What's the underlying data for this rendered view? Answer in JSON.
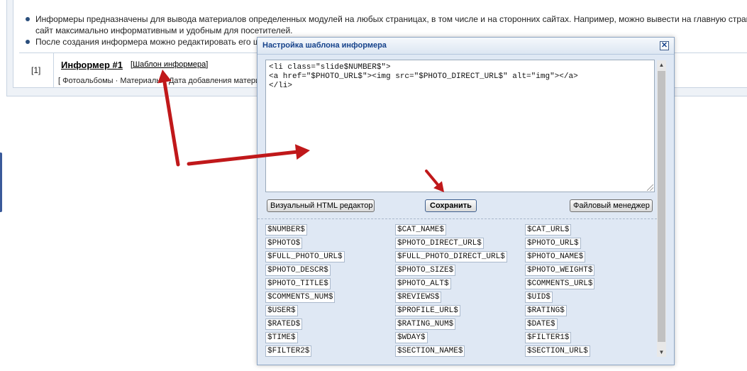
{
  "page": {
    "notes": [
      "Информеры предназначены для вывода материалов определенных модулей на любых страницах, в том числе и на сторонних сайтах. Например, можно вывести на главную страни",
      "После создания информера можно редактировать его ш"
    ],
    "note_continuation": "сайт максимально информативным и удобным для посетителей.",
    "informer": {
      "number": "[1]",
      "title": "Информер #1",
      "template_open": "[",
      "template_link": "Шаблон информера",
      "template_close": "]",
      "description": "[ Фотоальбомы · Материалы · Дата добавления материала"
    }
  },
  "dialog": {
    "title": "Настройка шаблона информера",
    "close_glyph": "✕",
    "template_code": "<li class=\"slide$NUMBER$\">\n<a href=\"$PHOTO_URL$\"><img src=\"$PHOTO_DIRECT_URL$\" alt=\"img\"></a>\n</li>",
    "buttons": {
      "visual_editor": "Визуальный HTML редактор",
      "save": "Сохранить",
      "file_manager": "Файловый менеджер"
    },
    "variables": [
      [
        "$NUMBER$",
        "$CAT_NAME$",
        "$CAT_URL$"
      ],
      [
        "$PHOTO$",
        "$PHOTO_DIRECT_URL$",
        "$PHOTO_URL$"
      ],
      [
        "$FULL_PHOTO_URL$",
        "$FULL_PHOTO_DIRECT_URL$",
        "$PHOTO_NAME$"
      ],
      [
        "$PHOTO_DESCR$",
        "$PHOTO_SIZE$",
        "$PHOTO_WEIGHT$"
      ],
      [
        "$PHOTO_TITLE$",
        "$PHOTO_ALT$",
        "$COMMENTS_URL$"
      ],
      [
        "$COMMENTS_NUM$",
        "$REVIEWS$",
        "$UID$"
      ],
      [
        "$USER$",
        "$PROFILE_URL$",
        "$RATING$"
      ],
      [
        "$RATED$",
        "$RATING_NUM$",
        "$DATE$"
      ],
      [
        "$TIME$",
        "$WDAY$",
        "$FILTER1$"
      ],
      [
        "$FILTER2$",
        "$SECTION_NAME$",
        "$SECTION_URL$"
      ]
    ],
    "scroll_up_glyph": "▲",
    "scroll_down_glyph": "▼"
  },
  "colors": {
    "annotation_arrow": "#c0181a",
    "dialog_title": "#15428b",
    "dialog_bg": "#dfe8f4"
  }
}
